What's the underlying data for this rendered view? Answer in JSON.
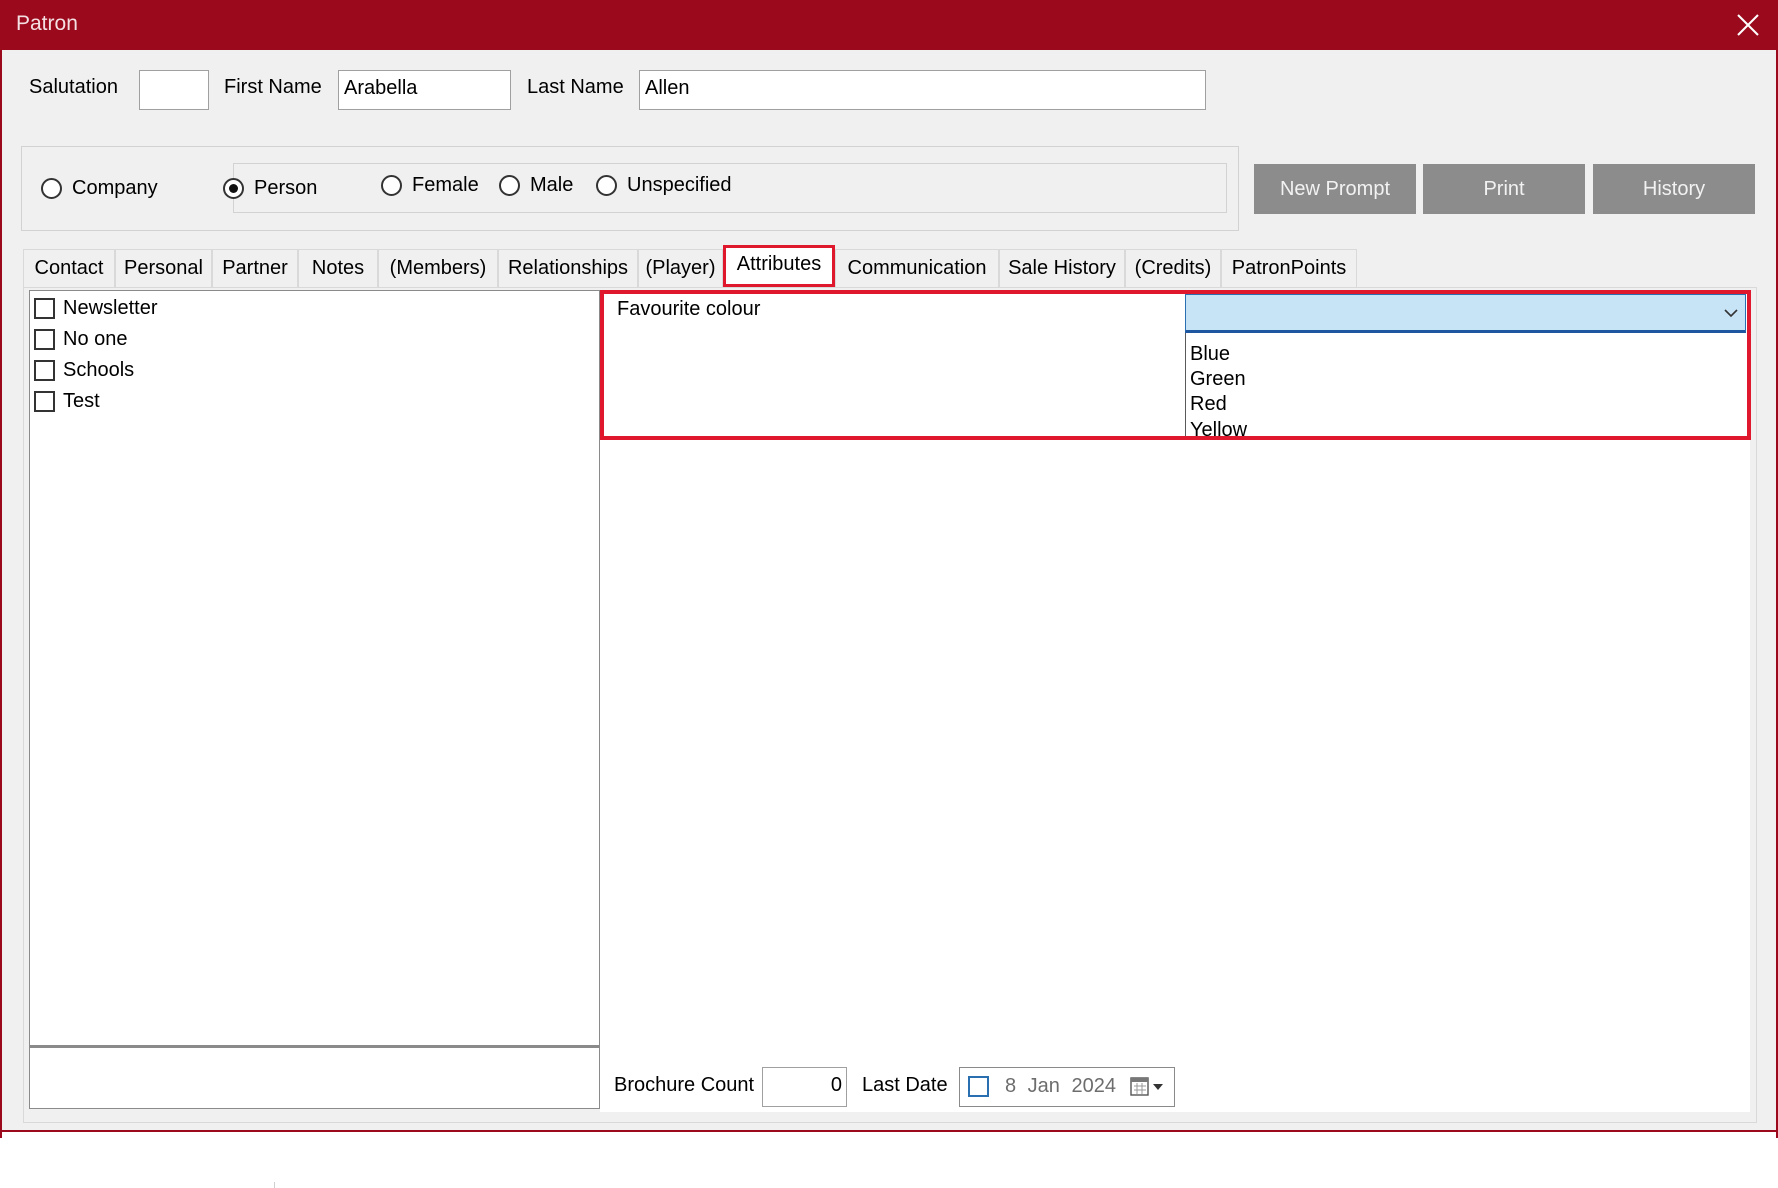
{
  "window": {
    "title": "Patron",
    "title_bar_color": "#9a0a1c"
  },
  "name_fields": {
    "salutation_label": "Salutation",
    "salutation_value": "",
    "first_name_label": "First Name",
    "first_name_value": "Arabella",
    "last_name_label": "Last Name",
    "last_name_value": "Allen"
  },
  "patron_type": {
    "options": [
      {
        "label": "Company",
        "selected": false
      },
      {
        "label": "Person",
        "selected": true
      }
    ],
    "gender_options": [
      {
        "label": "Female",
        "selected": false
      },
      {
        "label": "Male",
        "selected": false
      },
      {
        "label": "Unspecified",
        "selected": false
      }
    ]
  },
  "action_buttons": {
    "new_prompt": "New Prompt",
    "print": "Print",
    "history": "History"
  },
  "tabs": [
    {
      "label": "Contact",
      "active": false
    },
    {
      "label": "Personal",
      "active": false
    },
    {
      "label": "Partner",
      "active": false
    },
    {
      "label": "Notes",
      "active": false
    },
    {
      "label": "(Members)",
      "active": false
    },
    {
      "label": "Relationships",
      "active": false
    },
    {
      "label": "(Player)",
      "active": false
    },
    {
      "label": "Attributes",
      "active": true
    },
    {
      "label": "Communication",
      "active": false
    },
    {
      "label": "Sale History",
      "active": false
    },
    {
      "label": "(Credits)",
      "active": false
    },
    {
      "label": "PatronPoints",
      "active": false
    }
  ],
  "attributes_checklist": [
    {
      "label": "Newsletter",
      "checked": false
    },
    {
      "label": "No one",
      "checked": false
    },
    {
      "label": "Schools",
      "checked": false
    },
    {
      "label": "Test",
      "checked": false
    }
  ],
  "favourite_colour": {
    "label": "Favourite colour",
    "selected_value": "",
    "options": [
      "Blue",
      "Green",
      "Red",
      "Yellow"
    ]
  },
  "brochure": {
    "count_label": "Brochure Count",
    "count_value": "0",
    "last_date_label": "Last Date",
    "last_date_value": "8 Jan 2024",
    "last_date_checked": false
  },
  "colors": {
    "highlight": "#e0182d",
    "combo_selected_bg": "#c7e3f6",
    "button_bg": "#8c8c8c"
  },
  "icons": {
    "close": "close-icon",
    "dropdown": "chevron-down-icon",
    "calendar": "calendar-icon"
  }
}
